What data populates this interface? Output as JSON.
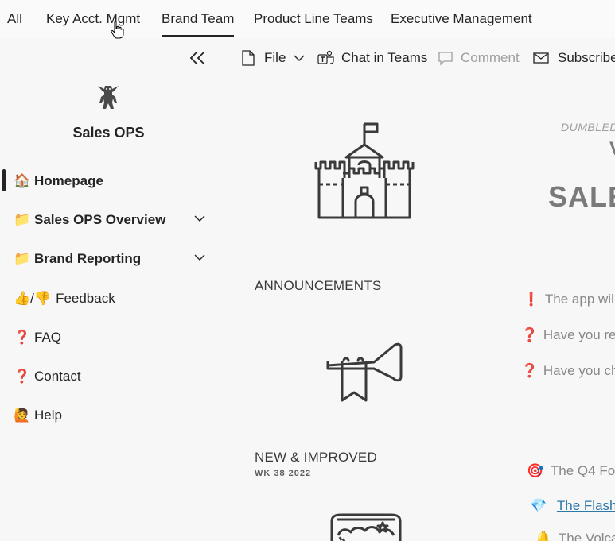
{
  "topnav": {
    "tabs": [
      {
        "label": "All"
      },
      {
        "label": "Key Acct. Mgmt"
      },
      {
        "label": "Brand Team"
      },
      {
        "label": "Product Line Teams"
      },
      {
        "label": "Executive Management"
      }
    ],
    "active": "Brand Team"
  },
  "commandbar": {
    "file_label": "File",
    "chat_label": "Chat in Teams",
    "comment_label": "Comment",
    "subscribe_label": "Subscribe"
  },
  "sidebar": {
    "site_title": "Sales OPS",
    "items": [
      {
        "emoji": "🏠",
        "label": "Homepage",
        "active": true
      },
      {
        "emoji": "📁",
        "label": "Sales OPS Overview",
        "expandable": true
      },
      {
        "emoji": "📁",
        "label": "Brand Reporting",
        "expandable": true
      },
      {
        "emoji": "👍/👎",
        "label": "Feedback"
      },
      {
        "emoji": "❓",
        "label": "FAQ"
      },
      {
        "emoji": "❓",
        "label": "Contact"
      },
      {
        "emoji": "🙋",
        "label": "Help"
      }
    ]
  },
  "content": {
    "eyebrow": "DUMBLED",
    "hero_letter": "V",
    "hero": "SALE",
    "announcements_title": "ANNOUNCEMENTS",
    "announcements": [
      {
        "emoji": "❗",
        "text": "The app will"
      },
      {
        "emoji": "❓",
        "text": "Have you reg"
      },
      {
        "emoji": "❓",
        "text": "Have you che"
      }
    ],
    "new_title": "NEW & IMPROVED",
    "new_sub": "WK 38 2022",
    "new_items": [
      {
        "emoji": "🎯",
        "text": "The Q4 Fo"
      },
      {
        "emoji": "💎",
        "text": "The Flash I"
      },
      {
        "emoji": "🔔",
        "text": "The Volcan"
      }
    ]
  },
  "colors": {
    "accent": "#252423",
    "link": "#2b79a8",
    "muted": "#a19f9d"
  },
  "icons": [
    "castle-icon",
    "trumpet-icon",
    "treasure-chest-icon",
    "goblin-logo-icon",
    "file-icon",
    "teams-icon",
    "comment-icon",
    "mail-icon",
    "chevron-down-icon",
    "double-chevron-left-icon",
    "hand-cursor-icon"
  ]
}
